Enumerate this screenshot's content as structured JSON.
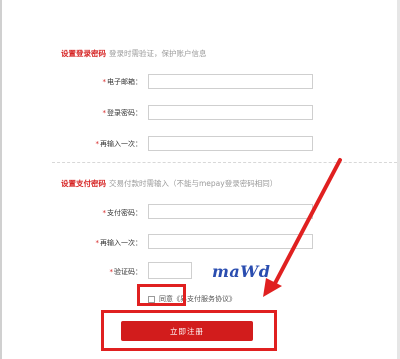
{
  "login_section": {
    "title": "设置登录密码",
    "hint": "登录时需验证，保护账户信息"
  },
  "login_fields": [
    {
      "required": "*",
      "label": "电子邮箱：",
      "value": ""
    },
    {
      "required": "*",
      "label": "登录密码：",
      "value": ""
    },
    {
      "required": "*",
      "label": "再输入一次：",
      "value": ""
    }
  ],
  "pay_section": {
    "title": "设置支付密码",
    "hint": "交易付款时需输入（不能与mepay登录密码相同）"
  },
  "pay_fields": [
    {
      "required": "*",
      "label": "支付密码：",
      "value": ""
    },
    {
      "required": "*",
      "label": "再输入一次：",
      "value": ""
    },
    {
      "required": "*",
      "label": "验证码：",
      "value": ""
    }
  ],
  "captcha": {
    "text": "maWd"
  },
  "agreement": {
    "prefix": "同意",
    "link": "《易支付服务协议》",
    "checked": false
  },
  "submit": {
    "label": "立即注册"
  },
  "colors": {
    "accent": "#d21c1c",
    "annotation": "#e02020",
    "captcha": "#2a4db0"
  }
}
